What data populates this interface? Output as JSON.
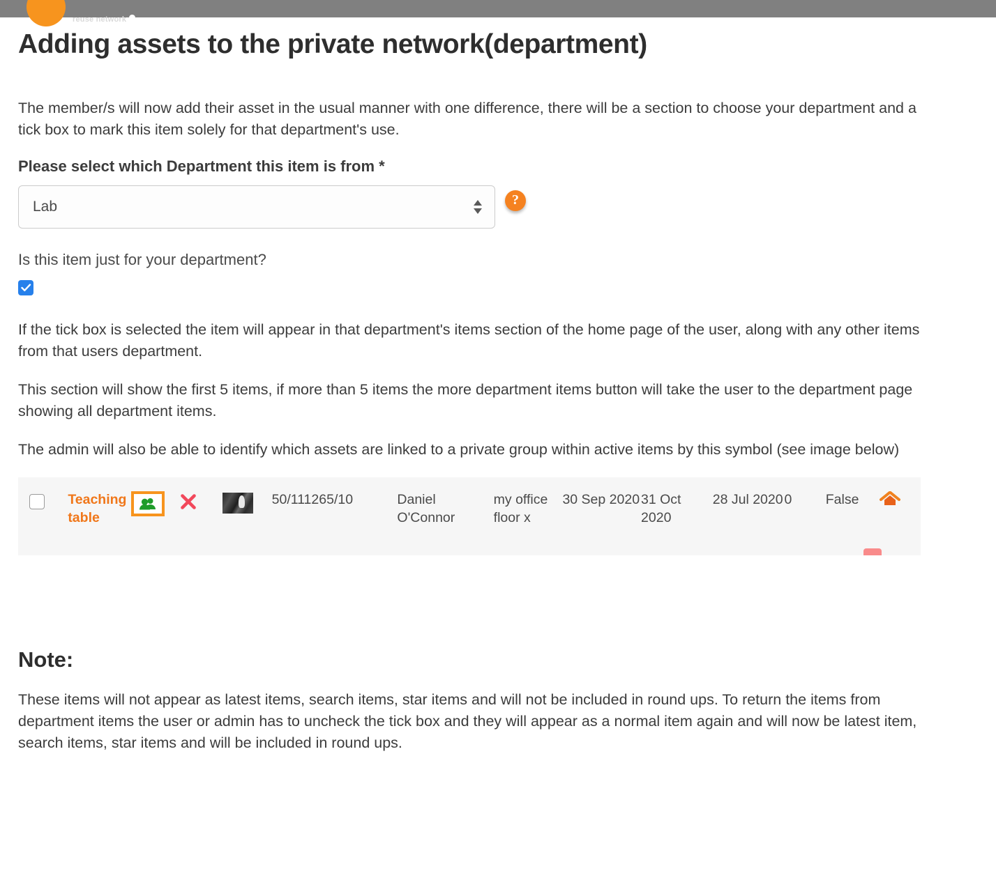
{
  "topbar": {
    "logo_text": "reuse network",
    "logo_icon": "orange-circle-logo",
    "leaf_icon": "leaf-icon"
  },
  "page_title": "Adding assets to the private network(department)",
  "paragraphs": {
    "intro": "The member/s will now add their asset in the usual manner with one difference, there will be a section to choose your department and a tick box to mark this item solely for that department's use.",
    "after_checkbox": "If the tick box is selected the item will appear in that department's items section of the home page of the user, along with any other items from that users department.",
    "five_items": "This section will show the first 5 items, if more than 5 items the more department items button will take the user to the department page showing all department items.",
    "admin_symbol": "The admin will also be able to identify which assets are linked to a private group within active items by this symbol (see image below)",
    "note_body": "These items will not appear as latest items, search items, star items and will not be included in round ups. To return the items from department items the user or admin has to uncheck the tick box and they will appear as a normal item again and will now be latest item, search items, star items and will be included in round ups."
  },
  "form": {
    "department_label": "Please select which Department this item is from *",
    "department_value": "Lab",
    "department_options": [
      "Lab"
    ],
    "help_icon": "question-mark-help-icon",
    "help_glyph": "?",
    "question_label": "Is this item just for your department?",
    "checkbox_checked": true,
    "checkbox_color": "#2680eb"
  },
  "table": {
    "row": {
      "select_checkbox_checked": false,
      "title": "Teaching table",
      "group_icon": "group-people-icon",
      "delete_icon": "red-x-delete-icon",
      "thumbnail": "item-photo-thumbnail",
      "reference": "50/111265/10",
      "owner": "Daniel O'Connor",
      "location": "my office floor x",
      "date_1": "30 Sep 2020",
      "date_2": "31 Oct 2020",
      "date_3": "28 Jul 2020",
      "count": "0",
      "flag": "False",
      "home_icon": "orange-home-icon"
    },
    "highlight_color": "#f7941e",
    "title_color": "#f0771a",
    "group_icon_color": "#1f9c2a",
    "delete_icon_color": "#f2485b",
    "home_icon_color": "#ee6c1a"
  },
  "note": {
    "heading": "Note:"
  }
}
